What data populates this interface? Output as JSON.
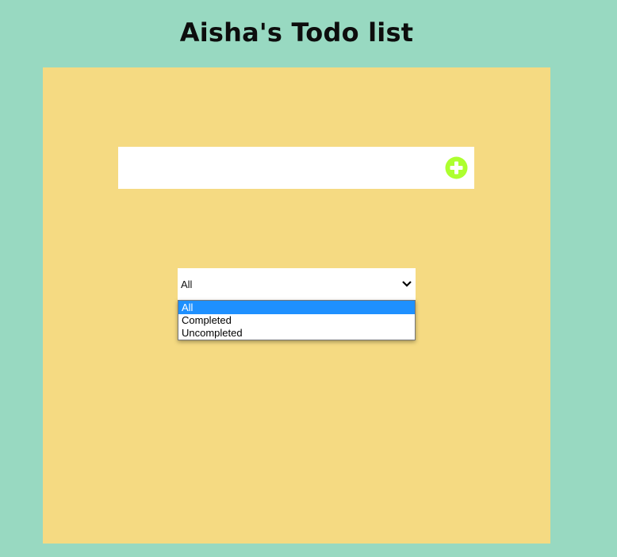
{
  "page": {
    "title": "Aisha's Todo list"
  },
  "todo_input": {
    "value": "",
    "placeholder": ""
  },
  "add_button": {
    "icon": "plus-circle-icon",
    "color": "#adff2f"
  },
  "filter": {
    "selected": "All",
    "options": [
      "All",
      "Completed",
      "Uncompleted"
    ],
    "highlighted_index": 0
  },
  "colors": {
    "background": "#98d9c1",
    "panel": "#f5da82",
    "highlight": "#1e90ff"
  }
}
